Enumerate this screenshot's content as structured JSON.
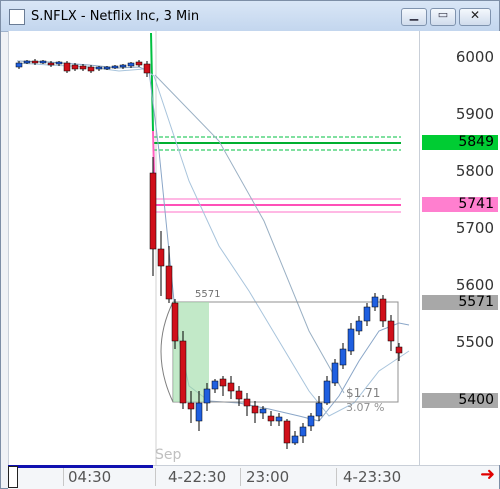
{
  "window": {
    "title": "S.NFLX - Netflix Inc, 3 Min",
    "buttons": {
      "minimize": "▁",
      "maximize": "▭",
      "close": "✕"
    }
  },
  "price_axis": {
    "ticks": [
      "6000",
      "5900",
      "5800",
      "5700",
      "5600",
      "5500",
      "5400"
    ]
  },
  "price_tags": [
    {
      "name": "green-level",
      "label": "5849",
      "bg": "#00cc33",
      "fg": "#000000"
    },
    {
      "name": "pink-level",
      "label": "5741",
      "bg": "#ff7fcf",
      "fg": "#000000"
    },
    {
      "name": "last-high",
      "label": "5571",
      "bg": "#a8a8a8",
      "fg": "#000000"
    },
    {
      "name": "last-low",
      "label": "5400",
      "bg": "#a8a8a8",
      "fg": "#000000"
    }
  ],
  "annotations": {
    "box_high_label": "5571",
    "change_value": "$1.71",
    "change_pct": "3.07 %",
    "month_label": "Sep"
  },
  "time_axis": {
    "labels": [
      "04:30",
      "4-22:30",
      "23:00",
      "4-23:30"
    ]
  },
  "colors": {
    "up": "#1f5fe0",
    "down": "#d0101a",
    "green": "#00b030",
    "pink": "#ff60c0"
  }
}
